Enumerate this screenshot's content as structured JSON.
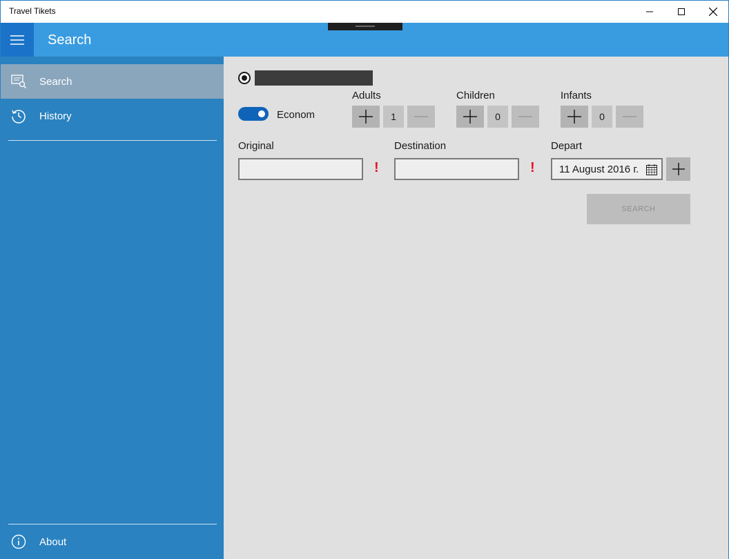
{
  "window": {
    "title": "Travel Tikets"
  },
  "header": {
    "title": "Search"
  },
  "sidebar": {
    "items": [
      {
        "label": "Search",
        "icon": "search-page-icon",
        "selected": true
      },
      {
        "label": "History",
        "icon": "history-icon",
        "selected": false
      }
    ],
    "footer": {
      "label": "About",
      "icon": "info-icon"
    }
  },
  "form": {
    "class_toggle": {
      "label": "Econom",
      "on": true
    },
    "adults": {
      "label": "Adults",
      "value": "1"
    },
    "children": {
      "label": "Children",
      "value": "0"
    },
    "infants": {
      "label": "Infants",
      "value": "0"
    },
    "origin": {
      "label": "Original",
      "value": "",
      "warning": "!"
    },
    "destination": {
      "label": "Destination",
      "value": "",
      "warning": "!"
    },
    "depart": {
      "label": "Depart",
      "value": "11 August 2016 г."
    },
    "search_button": "SEARCH"
  },
  "colors": {
    "header": "#3a9ce0",
    "sidebar": "#2a82c0",
    "selected_item": "#8aa6bd",
    "toggle_on": "#0f64b8",
    "warning": "#e81123"
  }
}
